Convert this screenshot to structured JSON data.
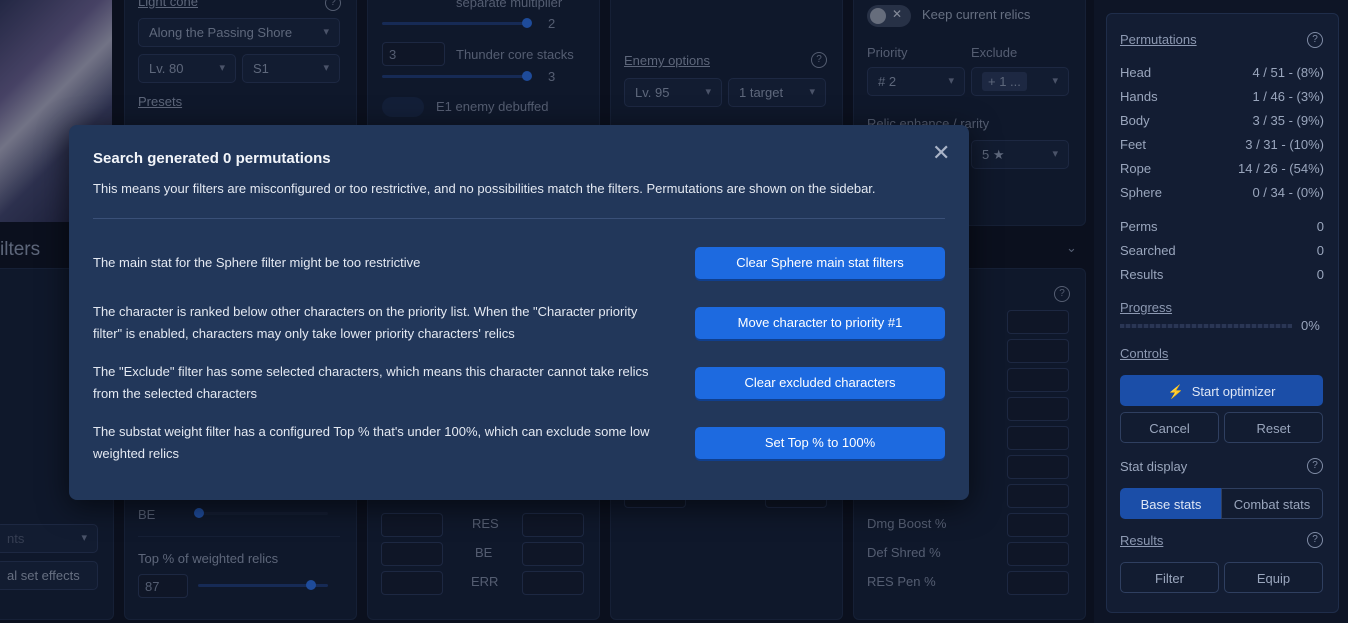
{
  "background": {
    "light_cone_label": "Light cone",
    "light_cone_value": "Along the Passing Shore",
    "level_value": "Lv. 80",
    "superimpose_value": "S1",
    "presets_label": "Presets",
    "separate_multiplier_label": "separate multiplier",
    "multiplier_value": "2",
    "thunder_core_input": "3",
    "thunder_core_label": "Thunder core stacks",
    "thunder_core_value": "3",
    "e1_label": "E1 enemy debuffed",
    "enemy_options_label": "Enemy options",
    "enemy_level": "Lv. 95",
    "enemy_targets": "1 target",
    "keep_relics_label": "Keep current relics",
    "priority_label": "Priority",
    "priority_value": "# 2",
    "exclude_label": "Exclude",
    "exclude_value": "+ 1 ...",
    "relic_enhance_label": "Relic enhance / rarity",
    "rarity_value": "5 ★",
    "filters_partial": "ilters",
    "sets_partial": "nts",
    "set_effects_partial": "al set effects",
    "be_label": "BE",
    "top_pct_label": "Top % of weighted relics",
    "top_pct_value": "87",
    "res_label": "RES",
    "be_label2": "BE",
    "err_label": "ERR",
    "dmg_boost_label": "Dmg Boost %",
    "def_shred_label": "Def Shred %",
    "res_pen_label": "RES Pen %"
  },
  "sidebar": {
    "permutations_label": "Permutations",
    "rows": [
      {
        "label": "Head",
        "value": "4 / 51 - (8%)"
      },
      {
        "label": "Hands",
        "value": "1 / 46 - (3%)"
      },
      {
        "label": "Body",
        "value": "3 / 35 - (9%)"
      },
      {
        "label": "Feet",
        "value": "3 / 31 - (10%)"
      },
      {
        "label": "Rope",
        "value": "14 / 26 - (54%)"
      },
      {
        "label": "Sphere",
        "value": "0 / 34 - (0%)"
      }
    ],
    "stats": [
      {
        "label": "Perms",
        "value": "0"
      },
      {
        "label": "Searched",
        "value": "0"
      },
      {
        "label": "Results",
        "value": "0"
      }
    ],
    "progress_label": "Progress",
    "progress_value": "0%",
    "controls_label": "Controls",
    "start_button": "Start optimizer",
    "cancel_button": "Cancel",
    "reset_button": "Reset",
    "stat_display_label": "Stat display",
    "base_stats_button": "Base stats",
    "combat_stats_button": "Combat stats",
    "results_label": "Results",
    "filter_button": "Filter",
    "equip_button": "Equip"
  },
  "modal": {
    "title": "Search generated 0 permutations",
    "subtitle": "This means your filters are misconfigured or too restrictive, and no possibilities match the filters. Permutations are shown on the sidebar.",
    "close_icon": "close-icon",
    "issues": [
      {
        "text": "The main stat for the Sphere filter might be too restrictive",
        "button": "Clear Sphere main stat filters"
      },
      {
        "text": "The character is ranked below other characters on the priority list. When the \"Character priority filter\" is enabled, characters may only take lower priority characters' relics",
        "button": "Move character to priority #1"
      },
      {
        "text": "The \"Exclude\" filter has some selected characters, which means this character cannot take relics from the selected characters",
        "button": "Clear excluded characters"
      },
      {
        "text": "The substat weight filter has a configured Top % that's under 100%, which can exclude some low weighted relics",
        "button": "Set Top % to 100%"
      }
    ]
  },
  "colors": {
    "modal_bg": "#22375a",
    "button_blue": "#1d6ae0",
    "page_bg": "#0e1526"
  }
}
